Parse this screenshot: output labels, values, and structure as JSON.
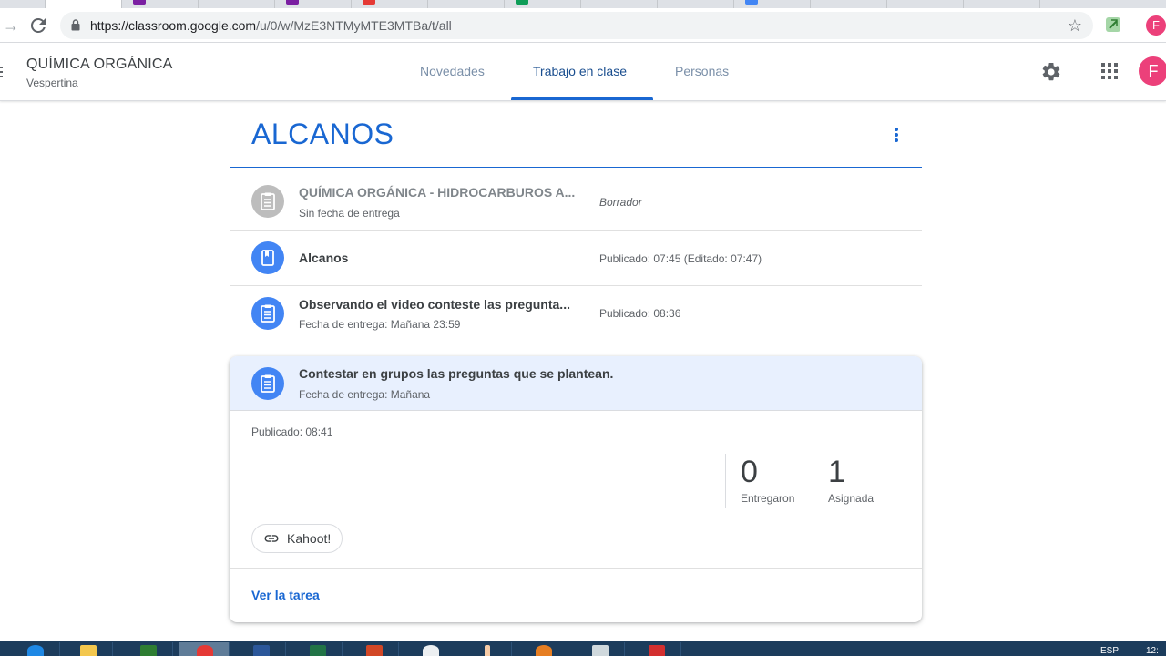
{
  "browser": {
    "url_host": "https://classroom.google.com",
    "url_path": "/u/0/w/MzE3NTMyMTE3MTBa/t/all",
    "profile_initial": "F"
  },
  "header": {
    "class_name": "QUÍMICA ORGÁNICA",
    "section": "Vespertina",
    "tabs": [
      {
        "label": "Novedades"
      },
      {
        "label": "Trabajo en clase"
      },
      {
        "label": "Personas"
      }
    ],
    "avatar_initial": "F"
  },
  "topic": {
    "title": "ALCANOS"
  },
  "items": [
    {
      "title": "QUÍMICA ORGÁNICA - HIDROCARBUROS A...",
      "subtitle": "Sin fecha de entrega",
      "meta": "Borrador",
      "icon": "assignment-icon"
    },
    {
      "title": "Alcanos",
      "subtitle": "",
      "meta": "Publicado: 07:45 (Editado: 07:47)",
      "icon": "material-icon"
    },
    {
      "title": "Observando el video conteste las pregunta...",
      "subtitle": "Fecha de entrega: Mañana 23:59",
      "meta": "Publicado: 08:36",
      "icon": "assignment-icon"
    }
  ],
  "expanded": {
    "title": "Contestar en grupos las preguntas que se plantean.",
    "subtitle": "Fecha de entrega: Mañana",
    "published": "Publicado: 08:41",
    "stats": [
      {
        "value": "0",
        "label": "Entregaron"
      },
      {
        "value": "1",
        "label": "Asignada"
      }
    ],
    "attachment": "Kahoot!",
    "view_link": "Ver la tarea"
  },
  "taskbar": {
    "lang": "ESP",
    "clock": "12:"
  },
  "colors": {
    "accent": "#1967d2",
    "icon_blue": "#4285f4",
    "draft_gray": "#bdbdbd",
    "avatar": "#ec407a"
  }
}
